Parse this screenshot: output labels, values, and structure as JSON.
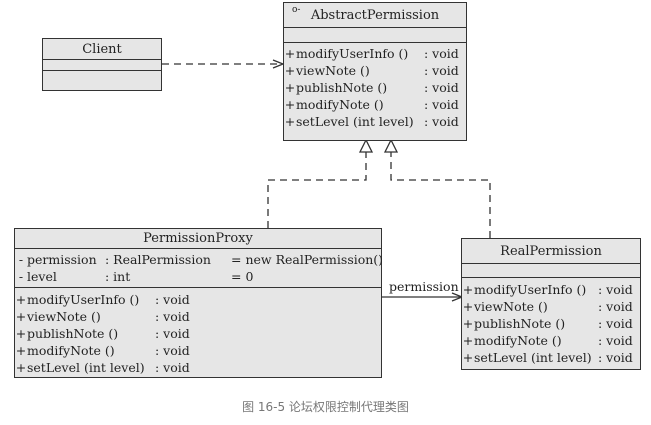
{
  "client": {
    "name": "Client"
  },
  "abstract_permission": {
    "name": "AbstractPermission",
    "marker": "o-",
    "methods": [
      {
        "vis": "+",
        "name": "modifyUserInfo ()",
        "type": ": void"
      },
      {
        "vis": "+",
        "name": "viewNote ()",
        "type": ": void"
      },
      {
        "vis": "+",
        "name": "publishNote ()",
        "type": ": void"
      },
      {
        "vis": "+",
        "name": "modifyNote ()",
        "type": ": void"
      },
      {
        "vis": "+",
        "name": "setLevel (int level)",
        "type": ": void"
      }
    ]
  },
  "permission_proxy": {
    "name": "PermissionProxy",
    "attributes": [
      {
        "vis": "-",
        "name": "permission",
        "type": ": RealPermission",
        "init": "= new RealPermission()"
      },
      {
        "vis": "-",
        "name": "level",
        "type": ": int",
        "init": "= 0"
      }
    ],
    "methods": [
      {
        "vis": "+",
        "name": "modifyUserInfo ()",
        "type": ": void"
      },
      {
        "vis": "+",
        "name": "viewNote ()",
        "type": ": void"
      },
      {
        "vis": "+",
        "name": "publishNote ()",
        "type": ": void"
      },
      {
        "vis": "+",
        "name": "modifyNote ()",
        "type": ": void"
      },
      {
        "vis": "+",
        "name": "setLevel (int level)",
        "type": ": void"
      }
    ]
  },
  "real_permission": {
    "name": "RealPermission",
    "methods": [
      {
        "vis": "+",
        "name": "modifyUserInfo ()",
        "type": ": void"
      },
      {
        "vis": "+",
        "name": "viewNote ()",
        "type": ": void"
      },
      {
        "vis": "+",
        "name": "publishNote ()",
        "type": ": void"
      },
      {
        "vis": "+",
        "name": "modifyNote ()",
        "type": ": void"
      },
      {
        "vis": "+",
        "name": "setLevel (int level)",
        "type": ": void"
      }
    ]
  },
  "association_label": "permission",
  "caption": "图 16-5   论坛权限控制代理类图"
}
